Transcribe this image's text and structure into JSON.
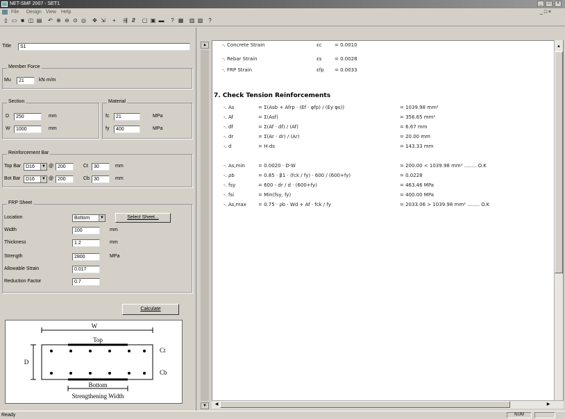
{
  "window": {
    "title": "NET-SMF 2007 - SET1",
    "minimize": "_",
    "maximize": "□",
    "close": "×"
  },
  "menu": [
    "File",
    "Design",
    "View",
    "Help"
  ],
  "toolbar_icons": [
    "new-icon",
    "open-icon",
    "save-icon",
    "preview-icon",
    "print-icon",
    "undo-icon",
    "zoom-in-icon",
    "zoom-out-icon",
    "zoom-window-icon",
    "zoom-all-icon",
    "pan-icon",
    "select-icon",
    "move-icon",
    "calc-icon",
    "mirror-icon",
    "rect-icon",
    "cube-icon",
    "help-icon",
    "grid-icon",
    "info-icon"
  ],
  "form": {
    "title_label": "Title",
    "title_value": "S1",
    "member_force": {
      "legend": "Member Force",
      "mu_label": "Mu",
      "mu_value": "21",
      "mu_unit": "kN·m/m"
    },
    "section": {
      "legend": "Section",
      "d_label": "D",
      "d_value": "250",
      "d_unit": "mm",
      "w_label": "W",
      "w_value": "1000",
      "w_unit": "mm"
    },
    "material": {
      "legend": "Material",
      "fc_label": "fc",
      "fc_value": "21",
      "fc_unit": "MPa",
      "fy_label": "fy",
      "fy_value": "400",
      "fy_unit": "MPa"
    },
    "reinforcement": {
      "legend": "Reinforcement Bar",
      "top_label": "Top Bar",
      "top_bar": "D16",
      "top_at": "@",
      "top_spacing": "200",
      "top_cover_label": "Ct",
      "top_cover": "30",
      "top_unit": "mm",
      "bot_label": "Bot Bar",
      "bot_bar": "D16",
      "bot_at": "@",
      "bot_spacing": "200",
      "bot_cover_label": "Cb",
      "bot_cover": "30",
      "bot_unit": "mm"
    },
    "frp": {
      "legend": "FRP Sheet",
      "location_label": "Location",
      "location_value": "Bottom",
      "select_button": "Select Sheet...",
      "width_label": "Width",
      "width_value": "100",
      "width_unit": "mm",
      "thickness_label": "Thickness",
      "thickness_value": "1.2",
      "thickness_unit": "mm",
      "strength_label": "Strength",
      "strength_value": "2800",
      "strength_unit": "MPa",
      "strain_label": "Allowable Strain",
      "strain_value": "0.017",
      "reduction_label": "Reduction Factor",
      "reduction_value": "0.7"
    },
    "calculate_button": "Calculate"
  },
  "diagram": {
    "w_label": "W",
    "top_label": "Top",
    "bottom_label": "Bottom",
    "d_label": "D",
    "ct_label": "Ct",
    "cb_label": "Cb",
    "width_label": "Strengthening Width"
  },
  "report": {
    "strains": [
      {
        "name": "-. Concrete Strain",
        "sym": "εc",
        "value": "= 0.0010"
      },
      {
        "name": "-. Rebar Strain",
        "sym": "εs",
        "value": "= 0.0028"
      },
      {
        "name": "-. FRP Strain",
        "sym": "εfp",
        "value": "= 0.0033"
      }
    ],
    "section_title": "7. Check Tension Reinforcements",
    "rows1": [
      {
        "sym": "-. As",
        "formula": "= Σ(Asb + Afrp · (Ef · φfp) / (Ey φs))",
        "result": "= 1039.98 mm²"
      },
      {
        "sym": "-. Af",
        "formula": "= Σ(Asf)",
        "result": "= 356.65 mm²"
      },
      {
        "sym": "-. df",
        "formula": "= Σ(Af · df) / (Af)",
        "result": "= 6.67 mm"
      },
      {
        "sym": "-. dr",
        "formula": "= Σ(Ar · dr) / (Ar)",
        "result": "= 20.00 mm"
      },
      {
        "sym": "-. d",
        "formula": "= H-ds",
        "result": "= 143.33 mm"
      }
    ],
    "rows2": [
      {
        "sym": "-. As,min",
        "formula": "= 0.0020 · D·W",
        "result": "= 200.00 < 1039.98 mm² ........ O.K"
      },
      {
        "sym": "-. ρb",
        "formula": "= 0.85 · β1 · (fck / fy) · 600 / (600+fy)",
        "result": "= 0.0228"
      },
      {
        "sym": "-. fsy",
        "formula": "= 600 - dr / d · (600+fy)",
        "result": "= 463.46 MPa"
      },
      {
        "sym": "-. fsi",
        "formula": "= Min(fsy, fy)",
        "result": "= 400.00 MPa"
      },
      {
        "sym": "-. As,max",
        "formula": "= 0.75 · ρb · Wd + Af · fck / fy",
        "result": "= 2033.06 > 1039.98 mm² ........ O.K"
      }
    ]
  },
  "status": {
    "text": "Ready",
    "num": "NUM"
  }
}
